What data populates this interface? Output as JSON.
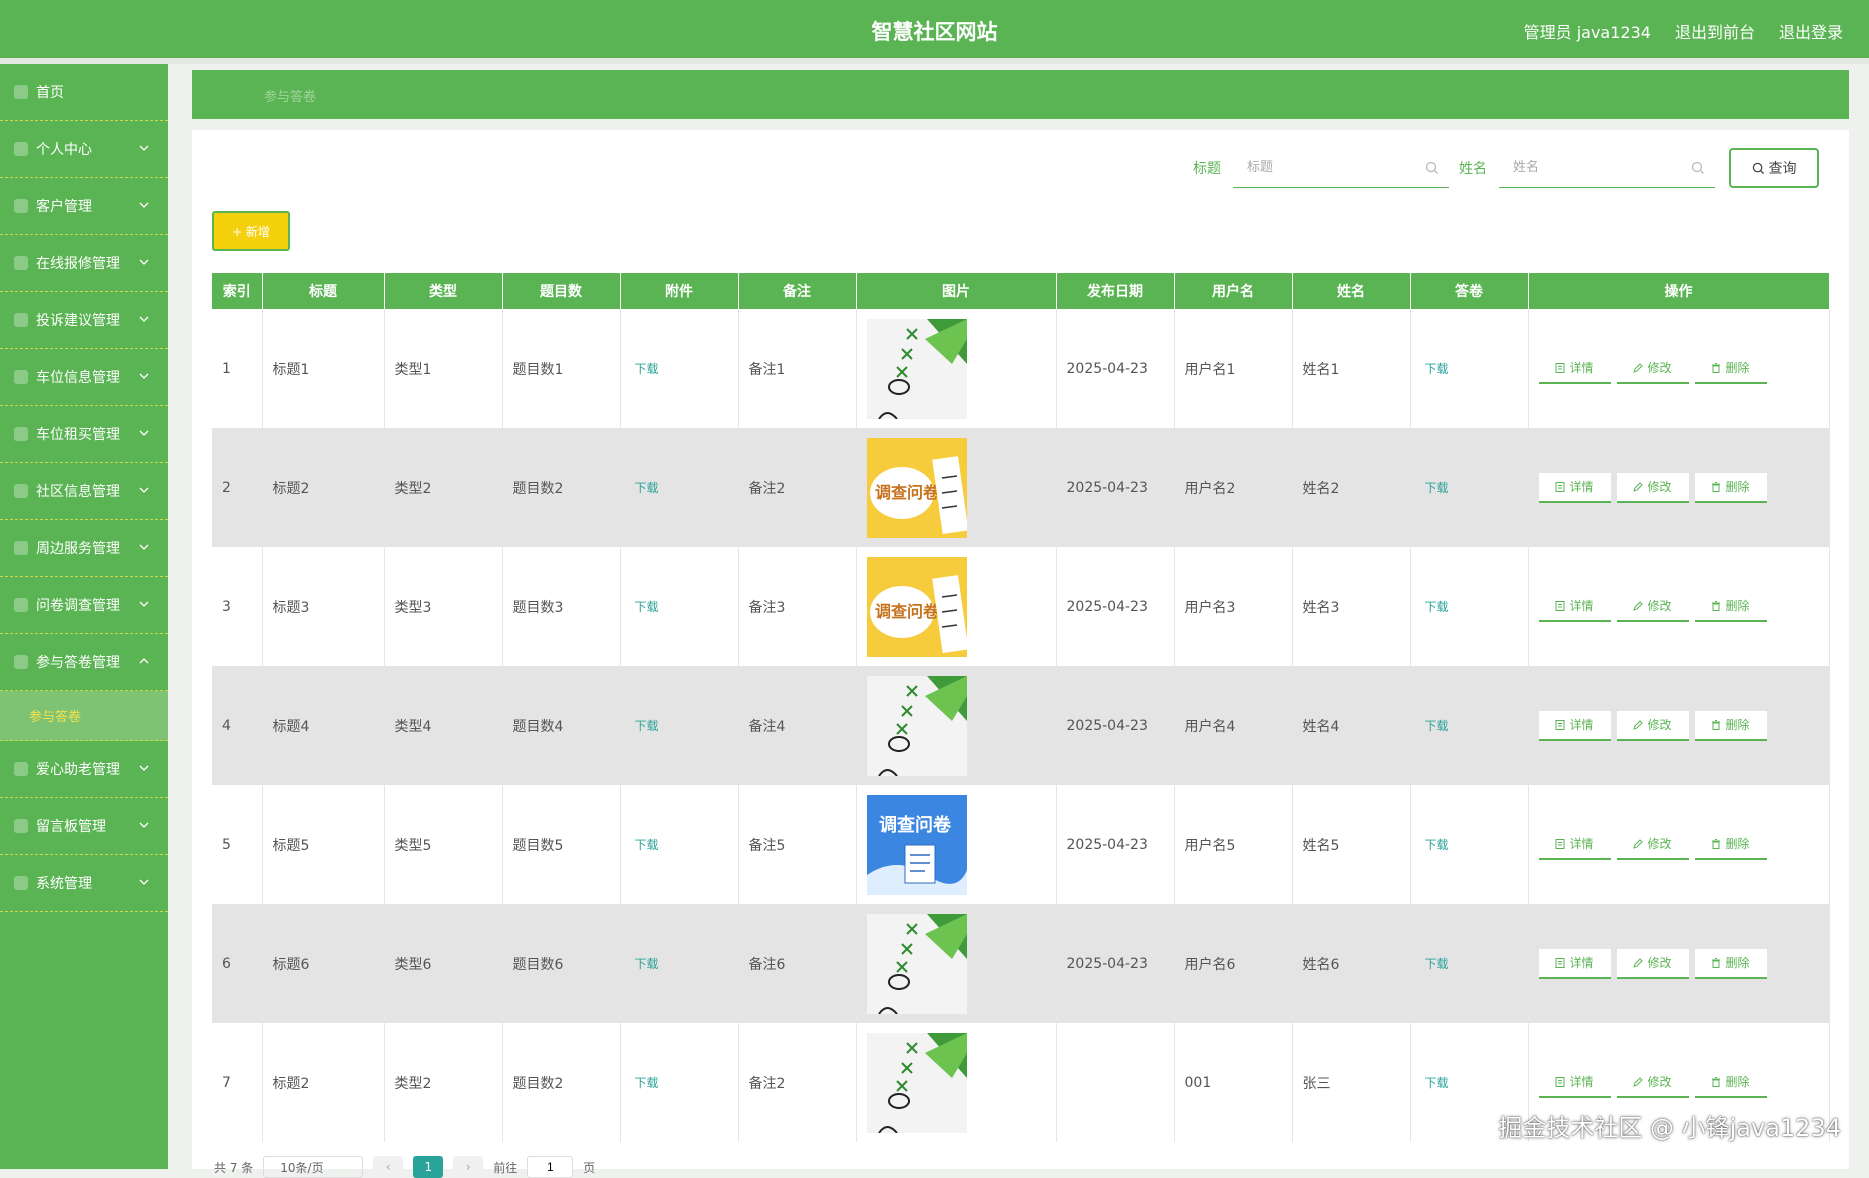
{
  "header": {
    "site_title": "智慧社区网站",
    "admin_label": "管理员 java1234",
    "front_link": "退出到前台",
    "logout_link": "退出登录"
  },
  "sidebar": {
    "items": [
      {
        "label": "首页",
        "has_arrow": false
      },
      {
        "label": "个人中心",
        "has_arrow": true
      },
      {
        "label": "客户管理",
        "has_arrow": true
      },
      {
        "label": "在线报修管理",
        "has_arrow": true
      },
      {
        "label": "投诉建议管理",
        "has_arrow": true
      },
      {
        "label": "车位信息管理",
        "has_arrow": true
      },
      {
        "label": "车位租买管理",
        "has_arrow": true
      },
      {
        "label": "社区信息管理",
        "has_arrow": true
      },
      {
        "label": "周边服务管理",
        "has_arrow": true
      },
      {
        "label": "问卷调查管理",
        "has_arrow": true
      },
      {
        "label": "参与答卷管理",
        "has_arrow": true,
        "expanded": true
      },
      {
        "label": "爱心助老管理",
        "has_arrow": true
      },
      {
        "label": "留言板管理",
        "has_arrow": true
      },
      {
        "label": "系统管理",
        "has_arrow": true
      }
    ],
    "sub_item": "参与答卷"
  },
  "breadcrumb": "参与答卷",
  "search": {
    "title_label": "标题",
    "title_placeholder": "标题",
    "name_label": "姓名",
    "name_placeholder": "姓名",
    "query_button": "查询"
  },
  "add_button": "+ 新增",
  "table": {
    "columns": [
      "索引",
      "标题",
      "类型",
      "题目数",
      "附件",
      "备注",
      "图片",
      "发布日期",
      "用户名",
      "姓名",
      "答卷",
      "操作"
    ],
    "rows": [
      {
        "index": "1",
        "title": "标题1",
        "type": "类型1",
        "count": "题目数1",
        "attach": "下载",
        "note": "备注1",
        "image": "checklist",
        "date": "2025-04-23",
        "username": "用户名1",
        "name": "姓名1",
        "answer": "下载"
      },
      {
        "index": "2",
        "title": "标题2",
        "type": "类型2",
        "count": "题目数2",
        "attach": "下载",
        "note": "备注2",
        "image": "survey-yellow",
        "date": "2025-04-23",
        "username": "用户名2",
        "name": "姓名2",
        "answer": "下载"
      },
      {
        "index": "3",
        "title": "标题3",
        "type": "类型3",
        "count": "题目数3",
        "attach": "下载",
        "note": "备注3",
        "image": "survey-yellow",
        "date": "2025-04-23",
        "username": "用户名3",
        "name": "姓名3",
        "answer": "下载"
      },
      {
        "index": "4",
        "title": "标题4",
        "type": "类型4",
        "count": "题目数4",
        "attach": "下载",
        "note": "备注4",
        "image": "checklist",
        "date": "2025-04-23",
        "username": "用户名4",
        "name": "姓名4",
        "answer": "下载"
      },
      {
        "index": "5",
        "title": "标题5",
        "type": "类型5",
        "count": "题目数5",
        "attach": "下载",
        "note": "备注5",
        "image": "survey-blue",
        "date": "2025-04-23",
        "username": "用户名5",
        "name": "姓名5",
        "answer": "下载"
      },
      {
        "index": "6",
        "title": "标题6",
        "type": "类型6",
        "count": "题目数6",
        "attach": "下载",
        "note": "备注6",
        "image": "checklist",
        "date": "2025-04-23",
        "username": "用户名6",
        "name": "姓名6",
        "answer": "下载"
      },
      {
        "index": "7",
        "title": "标题2",
        "type": "类型2",
        "count": "题目数2",
        "attach": "下载",
        "note": "备注2",
        "image": "checklist",
        "date": "",
        "username": "001",
        "name": "张三",
        "answer": "下载"
      }
    ],
    "actions": {
      "detail": "详情",
      "edit": "修改",
      "delete": "删除"
    }
  },
  "survey_text": "调查问卷",
  "pagination": {
    "total": "共 7 条",
    "page_size": "10条/页",
    "current_page": "1",
    "goto_label": "前往",
    "goto_value": "1",
    "page_unit": "页"
  },
  "watermark": "掘金技术社区 @ 小锋java1234",
  "colors": {
    "primary": "#5bb454",
    "accent_yellow": "#f5d10d",
    "link": "#2aa39b"
  }
}
